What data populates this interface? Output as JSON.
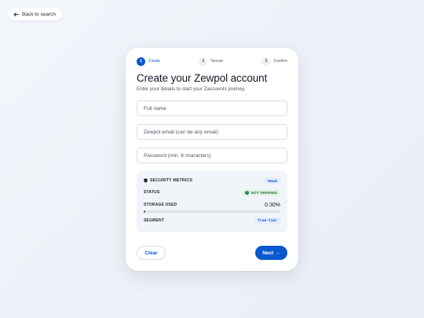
{
  "back": {
    "label": "Back to search",
    "icon": "arrow-left-icon"
  },
  "steps": [
    {
      "number": "1",
      "label": "Create",
      "active": true
    },
    {
      "number": "2",
      "label": "Secure",
      "active": false
    },
    {
      "number": "3",
      "label": "Confirm",
      "active": false
    }
  ],
  "form": {
    "title": "Create your Zewpol account",
    "subtitle": "Enter your details to start your Zaccounts journey.",
    "fields": {
      "full_name": {
        "placeholder": "Full name",
        "value": ""
      },
      "email": {
        "placeholder": "Zewpol email (can be any email)",
        "value": ""
      },
      "password": {
        "placeholder": "Password (min. 8 characters)",
        "value": ""
      }
    }
  },
  "metrics": {
    "title": "SECURITY METRICS",
    "strength_badge": "Weak",
    "status_label": "STATUS",
    "status_value": "NOT VERIFIED",
    "storage_label": "STORAGE USED",
    "storage_value": "0.30%",
    "storage_fraction": 0.003,
    "segment_label": "SEGMENT",
    "segment_value": "free-tier"
  },
  "actions": {
    "clear_label": "Clear",
    "next_label": "Next",
    "next_arrow": "→"
  },
  "colors": {
    "accent": "#0b57d0",
    "success": "#1e7f3b",
    "background": "#eef2f8"
  }
}
